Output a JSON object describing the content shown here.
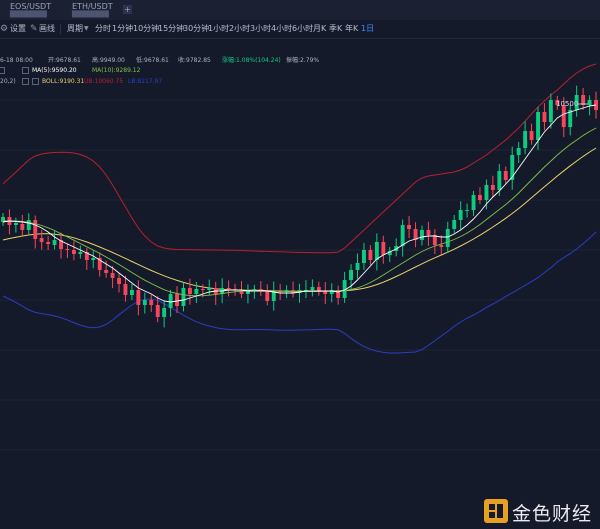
{
  "tabs": [
    {
      "symbol": "EOS/USDT",
      "sub": "████████"
    },
    {
      "symbol": "ETH/USDT",
      "sub": "████████"
    }
  ],
  "toolbar": {
    "settings_label": "设置",
    "draw_label": "画线",
    "period_label": "周期",
    "intervals": [
      "分时",
      "1分钟",
      "10分钟",
      "15分钟",
      "30分钟",
      "1小时",
      "2小时",
      "3小时",
      "4小时",
      "6小时",
      "月K",
      "季K",
      "年K",
      "1日"
    ],
    "active_interval": "1日"
  },
  "ohlc": {
    "date": "6-18 08:00",
    "open_label": "开:9678.61",
    "high_label": "高:9949.00",
    "low_label": "低:9678.61",
    "close_label": "收:9782.85",
    "change_label": "涨幅:1.08%(104.24)",
    "amplitude_label": "振幅:2.79%"
  },
  "ma": {
    "prefix": "20,2)",
    "ma5": "MA(5):9590.20",
    "ma10": "MA(10):9289.12"
  },
  "boll": {
    "boll": "BOLL:9190.31",
    "ub": "UB:10060.75",
    "lb": "LB:8217.87"
  },
  "colors": {
    "up": "#0ecb81",
    "down": "#f6465d",
    "ma5": "#ffffff",
    "ma10": "#7fc247",
    "boll_mid": "#e8d36a",
    "ub": "#b8202f",
    "lb": "#2a3dbf"
  },
  "watermark": "金色财经",
  "chart_data": {
    "type": "candlestick",
    "annotations": [
      {
        "label": "10500"
      }
    ],
    "candles_open": [
      9380,
      9430,
      9350,
      9360,
      9300,
      9400,
      9220,
      9180,
      9150,
      9200,
      9110,
      9100,
      9060,
      9080,
      9000,
      9020,
      8900,
      8870,
      8820,
      8760,
      8650,
      8700,
      8550,
      8600,
      8550,
      8430,
      8520,
      8660,
      8540,
      8720,
      8660,
      8710,
      8700,
      8720,
      8660,
      8720,
      8710,
      8700,
      8660,
      8690,
      8710,
      8700,
      8590,
      8690,
      8680,
      8700,
      8670,
      8700,
      8700,
      8730,
      8690,
      8660,
      8700,
      8620,
      8800,
      8900,
      8970,
      9100,
      9000,
      9180,
      9050,
      9090,
      9140,
      9350,
      9310,
      9200,
      9300,
      9250,
      9150,
      9130,
      9310,
      9400,
      9500,
      9500,
      9650,
      9600,
      9750,
      9700,
      9890,
      9800,
      10050,
      10120,
      10290,
      10200,
      10480,
      10380,
      10600,
      10550,
      10330,
      10500,
      10650,
      10550,
      10600
    ],
    "candles_close": [
      9430,
      9350,
      9370,
      9300,
      9400,
      9210,
      9180,
      9160,
      9200,
      9110,
      9100,
      9060,
      9080,
      9000,
      9020,
      8900,
      8870,
      8820,
      8760,
      8650,
      8700,
      8550,
      8600,
      8550,
      8430,
      8520,
      8660,
      8540,
      8720,
      8660,
      8710,
      8700,
      8720,
      8660,
      8720,
      8710,
      8700,
      8660,
      8690,
      8710,
      8700,
      8590,
      8690,
      8680,
      8700,
      8670,
      8700,
      8700,
      8730,
      8690,
      8660,
      8700,
      8620,
      8800,
      8900,
      8970,
      9100,
      9000,
      9180,
      9050,
      9090,
      9140,
      9350,
      9310,
      9200,
      9300,
      9250,
      9150,
      9130,
      9310,
      9400,
      9500,
      9500,
      9650,
      9600,
      9750,
      9700,
      9890,
      9800,
      10050,
      10120,
      10290,
      10200,
      10480,
      10380,
      10600,
      10550,
      10330,
      10500,
      10650,
      10550,
      10600,
      10500
    ],
    "ma5": [
      9380,
      9390,
      9385,
      9380,
      9370,
      9350,
      9320,
      9280,
      9230,
      9190,
      9160,
      9130,
      9100,
      9070,
      9040,
      9000,
      8960,
      8920,
      8870,
      8820,
      8770,
      8720,
      8690,
      8660,
      8620,
      8590,
      8580,
      8590,
      8600,
      8620,
      8640,
      8660,
      8680,
      8690,
      8690,
      8700,
      8700,
      8700,
      8690,
      8690,
      8690,
      8690,
      8680,
      8670,
      8670,
      8670,
      8680,
      8690,
      8690,
      8690,
      8690,
      8690,
      8680,
      8700,
      8740,
      8800,
      8870,
      8940,
      9010,
      9050,
      9080,
      9110,
      9150,
      9190,
      9210,
      9230,
      9240,
      9240,
      9230,
      9230,
      9260,
      9300,
      9350,
      9410,
      9480,
      9560,
      9630,
      9690,
      9760,
      9830,
      9920,
      10010,
      10100,
      10190,
      10280,
      10350,
      10420,
      10460,
      10480,
      10500,
      10520,
      10540,
      10550
    ],
    "ma10": [
      9390,
      9392,
      9390,
      9385,
      9375,
      9362,
      9345,
      9322,
      9295,
      9262,
      9230,
      9198,
      9165,
      9132,
      9100,
      9066,
      9030,
      8993,
      8955,
      8915,
      8875,
      8835,
      8798,
      8765,
      8733,
      8703,
      8680,
      8665,
      8652,
      8645,
      8642,
      8643,
      8648,
      8656,
      8665,
      8674,
      8682,
      8688,
      8691,
      8692,
      8692,
      8691,
      8690,
      8688,
      8687,
      8686,
      8685,
      8685,
      8685,
      8686,
      8687,
      8688,
      8690,
      8695,
      8705,
      8720,
      8745,
      8775,
      8810,
      8850,
      8890,
      8930,
      8970,
      9010,
      9050,
      9085,
      9115,
      9140,
      9160,
      9180,
      9205,
      9235,
      9270,
      9310,
      9355,
      9405,
      9455,
      9505,
      9555,
      9610,
      9670,
      9735,
      9800,
      9865,
      9930,
      9990,
      10050,
      10105,
      10155,
      10200,
      10245,
      10285,
      10320
    ],
    "boll_mid": [
      9200,
      9215,
      9228,
      9240,
      9250,
      9258,
      9262,
      9262,
      9258,
      9250,
      9238,
      9222,
      9202,
      9180,
      9156,
      9130,
      9103,
      9075,
      9046,
      9016,
      8985,
      8954,
      8924,
      8895,
      8868,
      8842,
      8818,
      8796,
      8776,
      8758,
      8742,
      8730,
      8720,
      8712,
      8706,
      8702,
      8700,
      8699,
      8698,
      8697,
      8696,
      8694,
      8692,
      8690,
      8689,
      8688,
      8688,
      8688,
      8688,
      8689,
      8690,
      8690,
      8691,
      8693,
      8698,
      8706,
      8718,
      8734,
      8754,
      8778,
      8805,
      8835,
      8866,
      8898,
      8930,
      8962,
      8993,
      9022,
      9050,
      9078,
      9108,
      9140,
      9174,
      9210,
      9248,
      9288,
      9330,
      9373,
      9418,
      9465,
      9515,
      9568,
      9622,
      9677,
      9732,
      9786,
      9840,
      9892,
      9942,
      9990,
      10036,
      10080,
      10120
    ],
    "boll_ub": [
      9760,
      9820,
      9880,
      9940,
      10000,
      10040,
      10060,
      10070,
      10075,
      10077,
      10076,
      10070,
      10055,
      10030,
      9990,
      9930,
      9850,
      9750,
      9640,
      9530,
      9420,
      9320,
      9240,
      9180,
      9140,
      9120,
      9110,
      9105,
      9104,
      9103,
      9102,
      9101,
      9100,
      9100,
      9099,
      9098,
      9097,
      9095,
      9092,
      9090,
      9088,
      9086,
      9084,
      9082,
      9080,
      9078,
      9076,
      9075,
      9074,
      9073,
      9072,
      9072,
      9080,
      9120,
      9180,
      9240,
      9300,
      9360,
      9420,
      9480,
      9540,
      9600,
      9660,
      9720,
      9780,
      9820,
      9840,
      9850,
      9860,
      9870,
      9880,
      9900,
      9930,
      9970,
      10010,
      10050,
      10100,
      10150,
      10200,
      10260,
      10320,
      10390,
      10460,
      10530,
      10590,
      10650,
      10700,
      10760,
      10820,
      10870,
      10910,
      10940,
      10960
    ],
    "boll_lb": [
      8640,
      8610,
      8576,
      8540,
      8500,
      8476,
      8464,
      8454,
      8441,
      8423,
      8400,
      8374,
      8349,
      8330,
      8322,
      8330,
      8356,
      8400,
      8452,
      8502,
      8550,
      8588,
      8608,
      8610,
      8596,
      8564,
      8526,
      8487,
      8448,
      8413,
      8382,
      8359,
      8340,
      8324,
      8313,
      8306,
      8303,
      8303,
      8304,
      8304,
      8304,
      8302,
      8300,
      8298,
      8298,
      8298,
      8300,
      8301,
      8302,
      8305,
      8308,
      8308,
      8302,
      8266,
      8216,
      8172,
      8136,
      8108,
      8088,
      8076,
      8070,
      8070,
      8072,
      8076,
      8080,
      8104,
      8146,
      8194,
      8240,
      8286,
      8336,
      8380,
      8418,
      8450,
      8486,
      8526,
      8560,
      8596,
      8636,
      8670,
      8710,
      8746,
      8784,
      8824,
      8874,
      8922,
      8980,
      9024,
      9064,
      9110,
      9162,
      9220,
      9280
    ]
  }
}
